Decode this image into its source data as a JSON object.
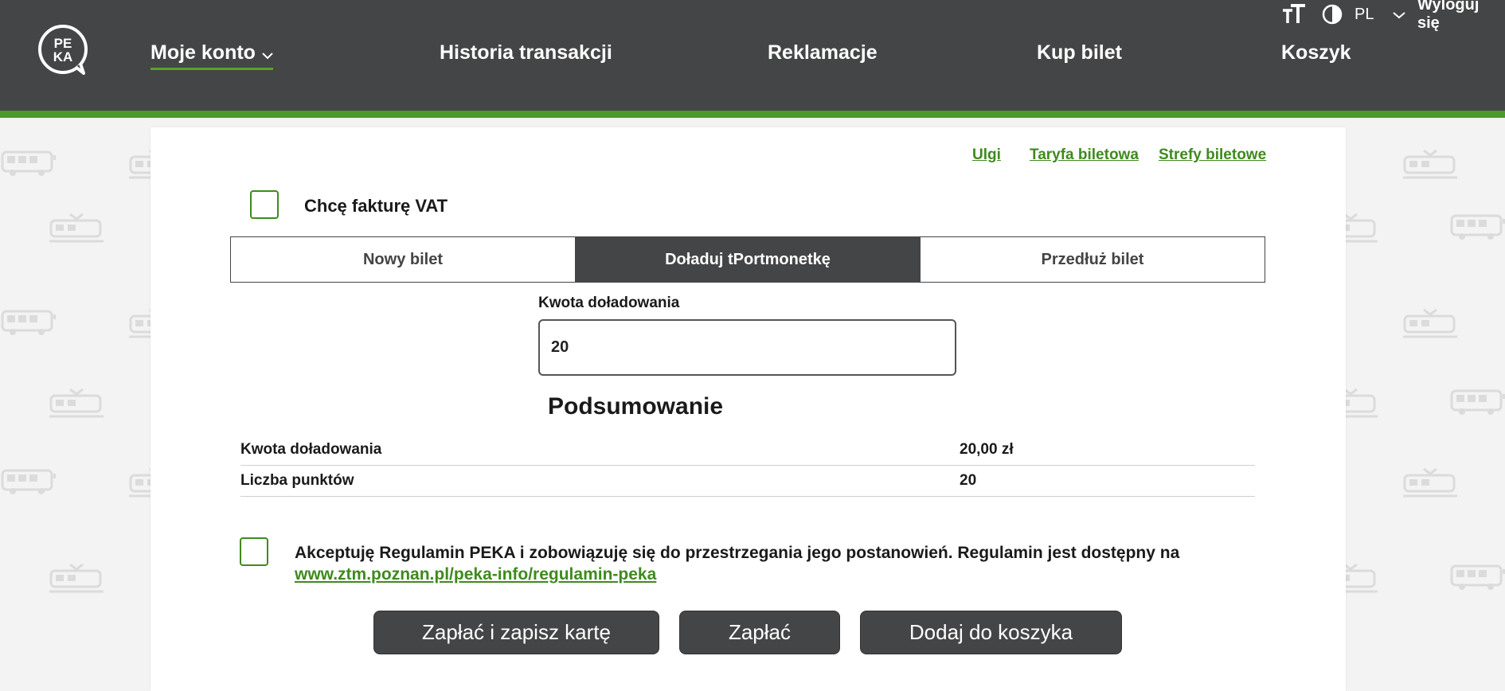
{
  "header": {
    "logo_text_top": "PE",
    "logo_text_bottom": "KA",
    "nav": [
      {
        "label": "Moje konto"
      },
      {
        "label": "Historia transakcji"
      },
      {
        "label": "Reklamacje"
      },
      {
        "label": "Kup bilet"
      },
      {
        "label": "Koszyk"
      }
    ],
    "language": "PL",
    "logout_label": "Wyloguj się"
  },
  "card": {
    "links": [
      "Ulgi",
      "Taryfa biletowa",
      "Strefy biletowe"
    ],
    "vat_label": "Chcę fakturę VAT",
    "tabs": [
      {
        "label": "Nowy bilet",
        "active": false
      },
      {
        "label": "Doładuj tPortmonetkę",
        "active": true
      },
      {
        "label": "Przedłuż bilet",
        "active": false
      }
    ],
    "amount_field": {
      "label": "Kwota doładowania",
      "value": "20"
    },
    "summary": {
      "title": "Podsumowanie",
      "rows": [
        {
          "key": "Kwota doładowania",
          "value": "20,00 zł"
        },
        {
          "key": "Liczba punktów",
          "value": "20"
        }
      ]
    },
    "terms": {
      "text": "Akceptuję Regulamin PEKA i zobowiązuję się do przestrzegania jego postanowień. Regulamin jest dostępny na",
      "link": "www.ztm.poznan.pl/peka-info/regulamin-peka"
    },
    "buttons": {
      "pay_save": "Zapłać i zapisz kartę",
      "pay": "Zapłać",
      "add_cart": "Dodaj do koszyka"
    }
  },
  "colors": {
    "header_bg": "#444546",
    "accent_green": "#4e9a29",
    "link_green": "#3f8a1e"
  }
}
